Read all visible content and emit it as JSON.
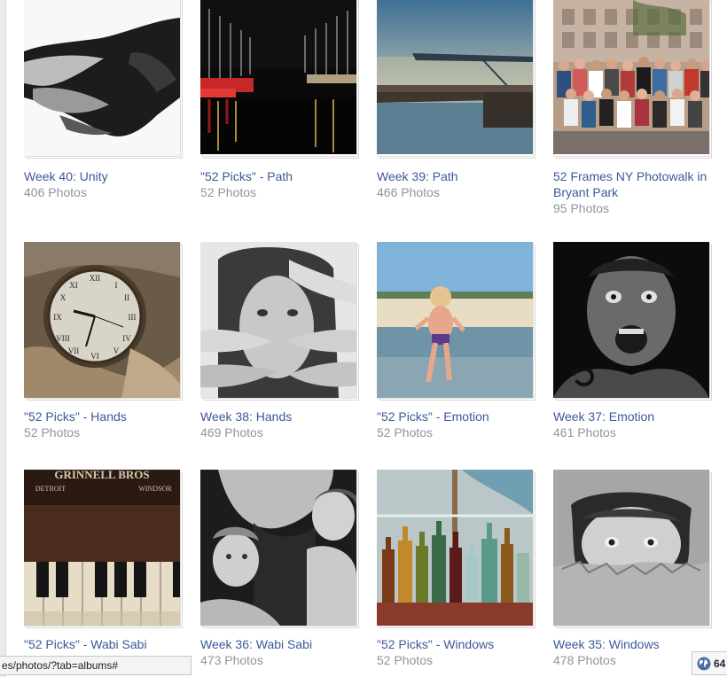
{
  "albums": [
    {
      "title": "Week 40: Unity",
      "count": "406 Photos",
      "icon": "hands-photo"
    },
    {
      "title": "\"52 Picks\" - Path",
      "count": "52 Photos",
      "icon": "marina-night-photo"
    },
    {
      "title": "Week 39: Path",
      "count": "466 Photos",
      "icon": "seaplane-dock-photo"
    },
    {
      "title": "52 Frames NY Photowalk in Bryant Park",
      "count": "95 Photos",
      "icon": "group-photo"
    },
    {
      "title": "\"52 Picks\" - Hands",
      "count": "52 Photos",
      "icon": "clock-hands-photo"
    },
    {
      "title": "Week 38: Hands",
      "count": "469 Photos",
      "icon": "face-hands-photo"
    },
    {
      "title": "\"52 Picks\" - Emotion",
      "count": "52 Photos",
      "icon": "child-beach-photo"
    },
    {
      "title": "Week 37: Emotion",
      "count": "461 Photos",
      "icon": "screaming-man-photo"
    },
    {
      "title": "\"52 Picks\" - Wabi Sabi",
      "count": "52 Photos",
      "icon": "old-piano-photo"
    },
    {
      "title": "Week 36: Wabi Sabi",
      "count": "473 Photos",
      "icon": "pregnant-belly-kids-photo"
    },
    {
      "title": "\"52 Picks\" - Windows",
      "count": "52 Photos",
      "icon": "bottles-window-photo"
    },
    {
      "title": "Week 35: Windows",
      "count": "478 Photos",
      "icon": "boy-cardboard-photo"
    }
  ],
  "thumb_text": {
    "piano_brand": "GRINNELL BROS",
    "piano_city_left": "DETROIT",
    "piano_city_right": "WINDSOR"
  },
  "status_bar": {
    "url": "es/photos/?tab=albums#"
  },
  "chat": {
    "icon": "globe-icon",
    "count": "64"
  },
  "colors": {
    "link": "#3b5998",
    "meta": "#90949c"
  }
}
